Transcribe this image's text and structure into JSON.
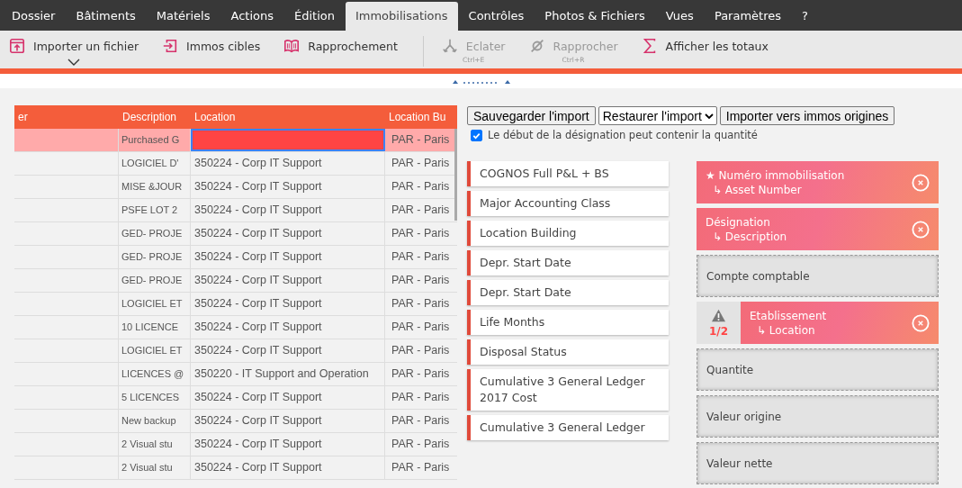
{
  "menu": [
    {
      "label": "Dossier",
      "selected": false
    },
    {
      "label": "Bâtiments",
      "selected": false
    },
    {
      "label": "Matériels",
      "selected": false
    },
    {
      "label": "Actions",
      "selected": false
    },
    {
      "label": "Édition",
      "selected": false
    },
    {
      "label": "Immobilisations",
      "selected": true
    },
    {
      "label": "Contrôles",
      "selected": false
    },
    {
      "label": "Photos & Fichiers",
      "selected": false
    },
    {
      "label": "Vues",
      "selected": false
    },
    {
      "label": "Paramètres",
      "selected": false
    },
    {
      "label": "?",
      "selected": false
    }
  ],
  "toolbar": {
    "groups": [
      [
        {
          "label": "Importer un fichier",
          "has_menu": true,
          "disabled": false
        },
        {
          "label": "Immos cibles",
          "disabled": false
        },
        {
          "label": "Rapprochement",
          "disabled": false
        }
      ],
      [
        {
          "label": "Eclater",
          "shortcut": "Ctrl+E",
          "disabled": true
        },
        {
          "label": "Rapprocher",
          "shortcut": "Ctrl+R",
          "disabled": true
        },
        {
          "label": "Afficher les totaux",
          "disabled": false
        }
      ]
    ]
  },
  "table": {
    "columns": [
      "er",
      "Description",
      "Location",
      "Location Bu"
    ],
    "rows": [
      {
        "selected": true,
        "description": "Purchased G",
        "location_building": "PAR - Paris"
      },
      {
        "selected": false,
        "description": "LOGICIEL D'",
        "location": "350224 - Corp IT Support",
        "location_building": "PAR - Paris"
      },
      {
        "selected": false,
        "description": "MISE &JOUR",
        "location": "350224 - Corp IT Support",
        "location_building": "PAR - Paris"
      },
      {
        "selected": false,
        "description": "PSFE LOT 2",
        "location": "350224 - Corp IT Support",
        "location_building": "PAR - Paris"
      },
      {
        "selected": false,
        "description": "GED- PROJE",
        "location": "350224 - Corp IT Support",
        "location_building": "PAR - Paris"
      },
      {
        "selected": false,
        "description": "GED- PROJE",
        "location": "350224 - Corp IT Support",
        "location_building": "PAR - Paris"
      },
      {
        "selected": false,
        "description": "GED- PROJE",
        "location": "350224 - Corp IT Support",
        "location_building": "PAR - Paris"
      },
      {
        "selected": false,
        "description": "LOGICIEL ET",
        "location": "350224 - Corp IT Support",
        "location_building": "PAR - Paris"
      },
      {
        "selected": false,
        "description": "10 LICENCE",
        "location": "350224 - Corp IT Support",
        "location_building": "PAR - Paris"
      },
      {
        "selected": false,
        "description": "LOGICIEL ET",
        "location": "350224 - Corp IT Support",
        "location_building": "PAR - Paris"
      },
      {
        "selected": false,
        "description": "LICENCES @",
        "location": "350220 - IT Support and Operation",
        "location_building": "PAR - Paris"
      },
      {
        "selected": false,
        "description": "5 LICENCES",
        "location": "350224 - Corp IT Support",
        "location_building": "PAR - Paris"
      },
      {
        "selected": false,
        "description": "New backup",
        "location": "350224 - Corp IT Support",
        "location_building": "PAR - Paris"
      },
      {
        "selected": false,
        "description": "2 Visual stu",
        "location": "350224 - Corp IT Support",
        "location_building": "PAR - Paris"
      },
      {
        "selected": false,
        "description": "2 Visual stu",
        "location": "350224 - Corp IT Support",
        "location_building": "PAR - Paris"
      }
    ]
  },
  "import_actions": [
    {
      "kind": "button",
      "label": "Sauvegarder l'import"
    },
    {
      "kind": "select",
      "label": "Restaurer l'import"
    },
    {
      "kind": "button",
      "label": "Importer vers immos origines"
    }
  ],
  "quantity_option": {
    "label": "Le début de la désignation peut contenir la quantité",
    "checked": true
  },
  "source_fields": [
    "COGNOS Full P&L + BS",
    "Major Accounting Class",
    "Location Building",
    "Depr. Start Date",
    "Depr. Start Date",
    "Life Months",
    "Disposal Status",
    "Cumulative 3 General Ledger 2017 Cost",
    "Cumulative 3 General Ledger"
  ],
  "target_fields": [
    {
      "kind": "mapped",
      "title": "★ Numéro immobilisation",
      "source": "↳ Asset Number"
    },
    {
      "kind": "mapped",
      "title": "Désignation",
      "source": "↳ Description"
    },
    {
      "kind": "empty",
      "title": "Compte comptable"
    },
    {
      "kind": "mapped",
      "title": "Etablissement",
      "source": "↳ Location",
      "warning": "1/2"
    },
    {
      "kind": "empty",
      "title": "Quantite"
    },
    {
      "kind": "empty",
      "title": "Valeur origine"
    },
    {
      "kind": "empty",
      "title": "Valeur nette"
    }
  ]
}
